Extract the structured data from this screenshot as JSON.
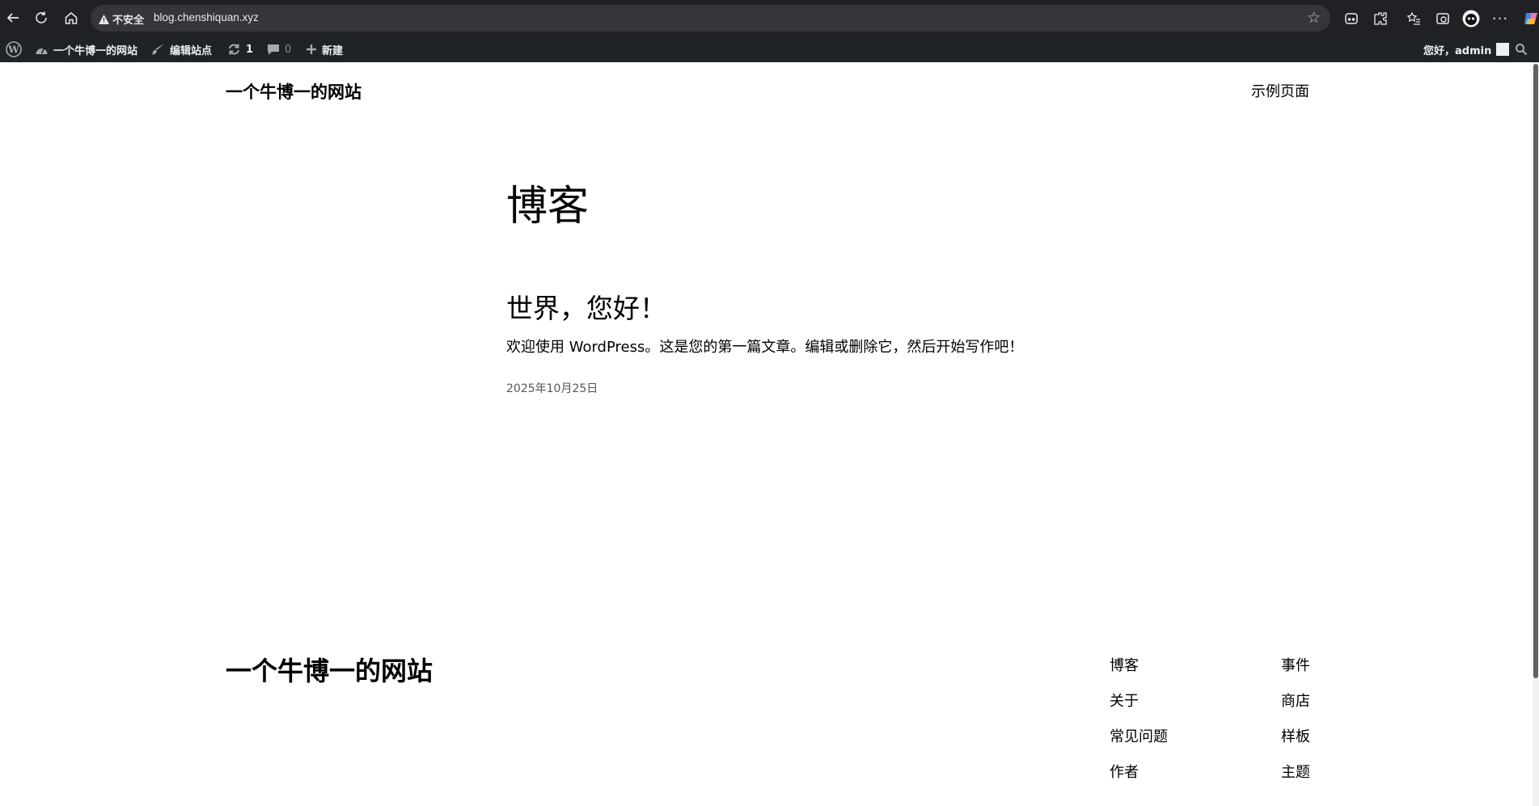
{
  "browser": {
    "security_label": "不安全",
    "url": "blog.chenshiquan.xyz"
  },
  "admin_bar": {
    "site_name": "一个牛博一的网站",
    "edit_site": "编辑站点",
    "updates_count": "1",
    "comments_count": "0",
    "new_label": "新建",
    "greeting": "您好，admin"
  },
  "header": {
    "site_title": "一个牛博一的网站",
    "nav_item": "示例页面"
  },
  "main": {
    "page_heading": "博客",
    "post": {
      "title": "世界，您好！",
      "excerpt": "欢迎使用 WordPress。这是您的第一篇文章。编辑或删除它，然后开始写作吧！",
      "date": "2025年10月25日"
    }
  },
  "footer": {
    "site_title": "一个牛博一的网站",
    "links_col1": [
      "博客",
      "关于",
      "常见问题",
      "作者"
    ],
    "links_col2": [
      "事件",
      "商店",
      "样板",
      "主题"
    ]
  }
}
